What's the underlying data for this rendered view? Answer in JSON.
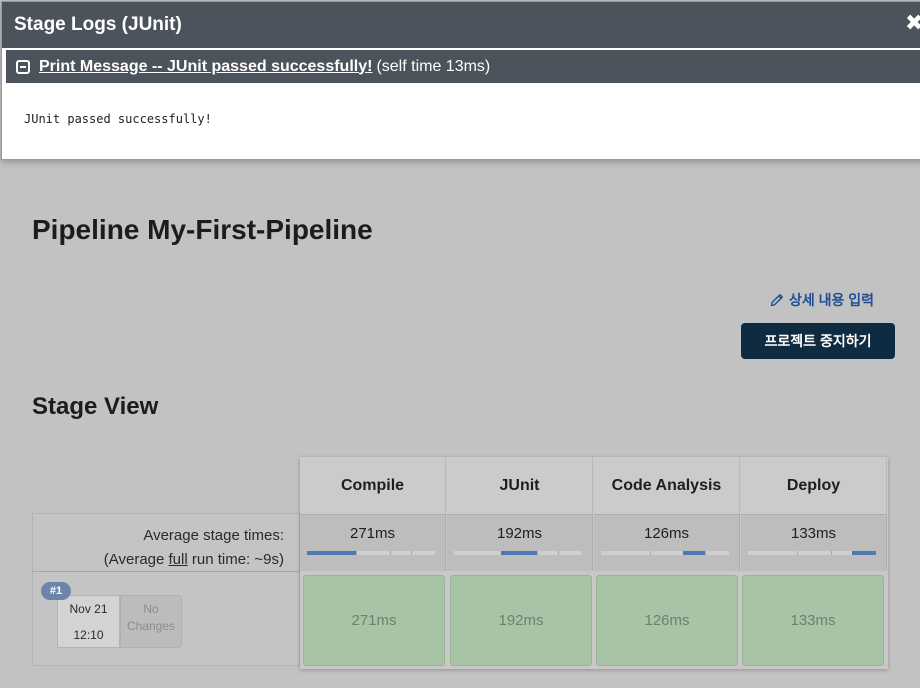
{
  "modal": {
    "title": "Stage Logs (JUnit)",
    "close_symbol": "✖",
    "step_link": "Print Message -- JUnit passed successfully!",
    "self_time": "(self time 13ms)",
    "log_output": "JUnit passed successfully!"
  },
  "page": {
    "title": "Pipeline My-First-Pipeline",
    "edit_description": "상세 내용 입력",
    "disable_project": "프로젝트 중지하기",
    "stage_view_title": "Stage View"
  },
  "stage_view": {
    "avg_label_line1": "Average stage times:",
    "avg_label_prefix": "(Average ",
    "avg_label_link": "full",
    "avg_label_suffix": " run time: ~9s)",
    "stages": [
      {
        "name": "Compile",
        "avg": "271ms",
        "progress_start": 0.0,
        "progress_end": 0.38
      },
      {
        "name": "JUnit",
        "avg": "192ms",
        "progress_start": 0.37,
        "progress_end": 0.65
      },
      {
        "name": "Code Analysis",
        "avg": "126ms",
        "progress_start": 0.64,
        "progress_end": 0.81
      },
      {
        "name": "Deploy",
        "avg": "133ms",
        "progress_start": 0.81,
        "progress_end": 1.0
      }
    ],
    "runs": [
      {
        "badge": "#1",
        "date": "Nov 21",
        "time": "12:10",
        "changes": "No Changes",
        "cells": [
          "271ms",
          "192ms",
          "126ms",
          "133ms"
        ]
      }
    ]
  },
  "colors": {
    "header_bg": "#4b535c",
    "button_bg": "#0e2b42",
    "link": "#1d4f95",
    "success_cell": "#a9c3a6",
    "progress_fill": "#4e79b4"
  }
}
